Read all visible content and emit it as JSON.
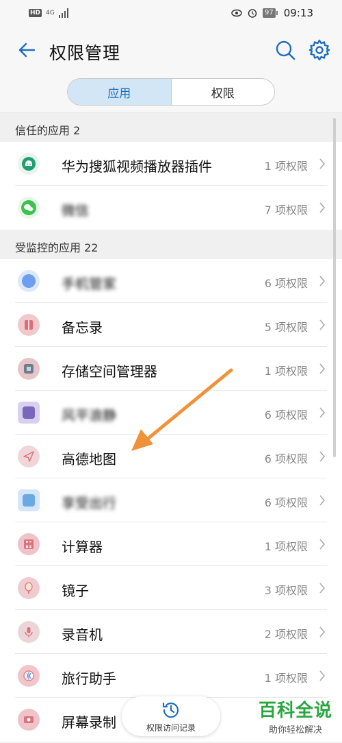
{
  "status_bar": {
    "hd": "HD",
    "network": "4G",
    "battery": "97",
    "time": "09:13"
  },
  "app_bar": {
    "title": "权限管理"
  },
  "tabs": [
    {
      "label": "应用",
      "active": true
    },
    {
      "label": "权限",
      "active": false
    }
  ],
  "sections": [
    {
      "header": "信任的应用 2",
      "items": [
        {
          "name": "华为搜狐视频播放器插件",
          "perms": "1 项权限",
          "icon": "android-icon",
          "blurred": false
        },
        {
          "name": "微信",
          "perms": "7 项权限",
          "icon": "wechat-icon",
          "blurred": true
        }
      ]
    },
    {
      "header": "受监控的应用 22",
      "items": [
        {
          "name": "手机管家",
          "perms": "6 项权限",
          "icon": "app-icon",
          "blurred": true
        },
        {
          "name": "备忘录",
          "perms": "5 项权限",
          "icon": "notepad-icon",
          "blurred": false
        },
        {
          "name": "存储空间管理器",
          "perms": "1 项权限",
          "icon": "storage-icon",
          "blurred": false
        },
        {
          "name": "风平浪静",
          "perms": "6 项权限",
          "icon": "app-icon",
          "blurred": true
        },
        {
          "name": "高德地图",
          "perms": "6 项权限",
          "icon": "map-icon",
          "blurred": false
        },
        {
          "name": "享受出行",
          "perms": "6 项权限",
          "icon": "app-icon",
          "blurred": true
        },
        {
          "name": "计算器",
          "perms": "1 项权限",
          "icon": "calculator-icon",
          "blurred": false
        },
        {
          "name": "镜子",
          "perms": "3 项权限",
          "icon": "mirror-icon",
          "blurred": false
        },
        {
          "name": "录音机",
          "perms": "2 项权限",
          "icon": "recorder-icon",
          "blurred": false
        },
        {
          "name": "旅行助手",
          "perms": "1 项权限",
          "icon": "travel-icon",
          "blurred": false
        },
        {
          "name": "屏幕录制",
          "perms": "",
          "icon": "screen-record-icon",
          "blurred": false
        }
      ]
    }
  ],
  "floating_button": {
    "label": "权限访问记录",
    "icon": "history-icon"
  },
  "watermark": {
    "main": "百科全说",
    "sub": "助你轻松解决"
  },
  "colors": {
    "accent": "#1e6ec0",
    "arrow": "#f0923a",
    "icon_pink": "#e8aeb4",
    "watermark_green": "#2aa640"
  }
}
